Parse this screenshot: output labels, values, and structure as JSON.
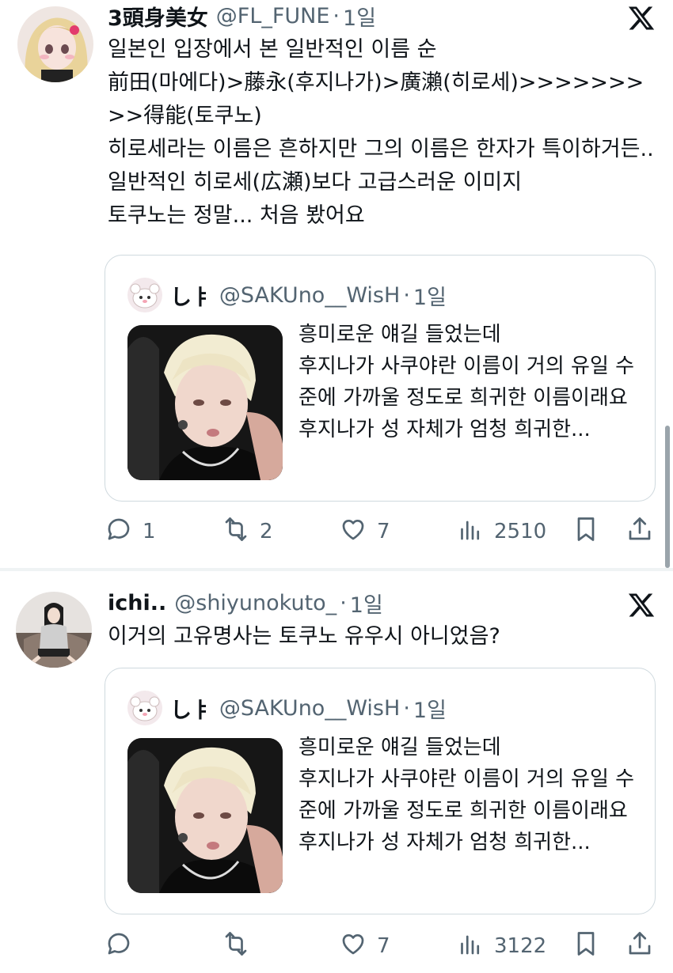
{
  "tweets": [
    {
      "author": {
        "name": "3頭身美女",
        "handle": "@FL_FUNE",
        "time": "1일"
      },
      "text": "일본인 입장에서 본 일반적인 이름 순\n前田(마에다)>藤永(후지나가)>廣瀨(히로세)>>>>>>>>>得能(토쿠노)\n히로세라는 이름은 흔하지만 그의 이름은 한자가 특이하거든.. 일반적인 히로세(広瀬)보다 고급스러운 이미지\n토쿠노는 정말... 처음 봤어요",
      "quote": {
        "name": "しㅑ",
        "handle": "@SAKUno__WisH",
        "time": "1일",
        "text": "흥미로운 얘길 들었는데\n후지나가 사쿠야란 이름이 거의 유일 수준에 가까울 정도로 희귀한 이름이래요\n후지나가 성 자체가 엄청 희귀한..."
      },
      "actions": {
        "reply": "1",
        "retweet": "2",
        "like": "7",
        "views": "2510"
      }
    },
    {
      "author": {
        "name": "ichi..",
        "handle": "@shiyunokuto_",
        "time": "1일"
      },
      "text": "이거의 고유명사는 토쿠노 유우시 아니었음?",
      "quote": {
        "name": "しㅑ",
        "handle": "@SAKUno__WisH",
        "time": "1일",
        "text": "흥미로운 얘길 들었는데\n후지나가 사쿠야란 이름이 거의 유일 수준에 가까울 정도로 희귀한 이름이래요\n후지나가 성 자체가 엄청 희귀한..."
      },
      "actions": {
        "reply": "",
        "retweet": "",
        "like": "7",
        "views": "3122"
      }
    }
  ],
  "meta": {
    "separator": "·"
  },
  "icons": {
    "x_logo": "x-logo-icon",
    "reply": "reply-icon",
    "retweet": "retweet-icon",
    "like": "heart-icon",
    "views": "views-icon",
    "bookmark": "bookmark-icon",
    "share": "share-icon"
  },
  "colors": {
    "text": "#0f1419",
    "secondary": "#536471",
    "border": "#cfd9de"
  }
}
